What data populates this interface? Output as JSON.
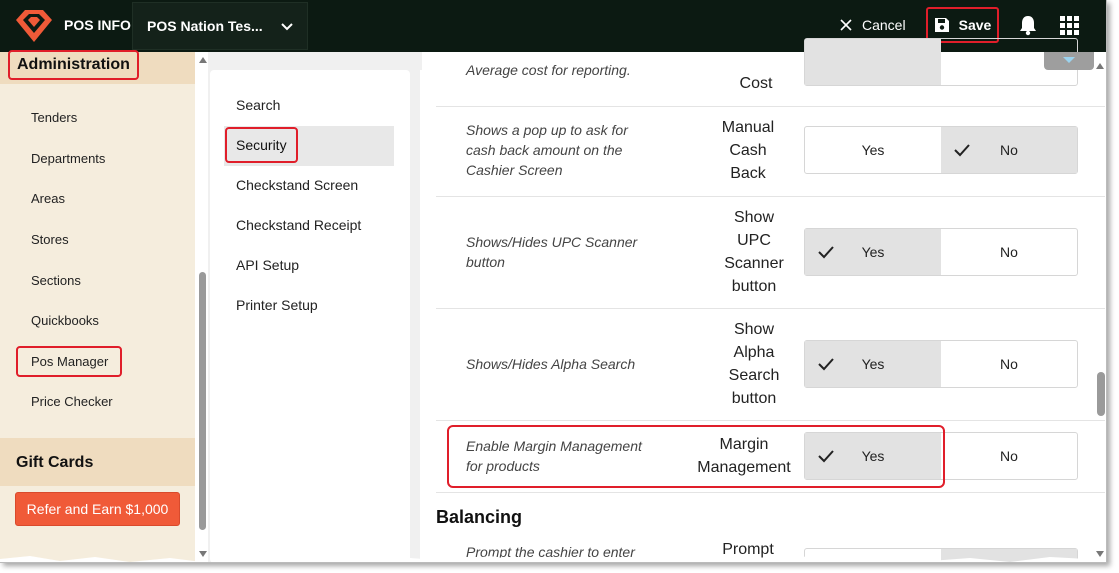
{
  "header": {
    "app_name": "POS INFO",
    "store_name": "POS Nation Tes...",
    "cancel_label": "Cancel",
    "save_label": "Save",
    "colors": {
      "topbar": "#0c1a12",
      "logo": "#f05a38",
      "highlight": "#e01e2a"
    }
  },
  "sidebar": {
    "section_title": "Administration",
    "items": [
      {
        "label": "Tenders"
      },
      {
        "label": "Departments"
      },
      {
        "label": "Areas"
      },
      {
        "label": "Stores"
      },
      {
        "label": "Sections"
      },
      {
        "label": "Quickbooks"
      },
      {
        "label": "Pos Manager",
        "active": true
      },
      {
        "label": "Price Checker"
      }
    ],
    "gift_title": "Gift Cards",
    "refer_label": "Refer and Earn $1,000"
  },
  "subnav": {
    "items": [
      {
        "label": "Search"
      },
      {
        "label": "Security",
        "active": true
      },
      {
        "label": "Checkstand Screen"
      },
      {
        "label": "Checkstand Receipt"
      },
      {
        "label": "API Setup"
      },
      {
        "label": "Printer Setup"
      }
    ]
  },
  "settings": {
    "rows": [
      {
        "description": "Average cost for reporting.",
        "name": "Cost",
        "selected": "No"
      },
      {
        "description": "Shows a pop up to ask for cash back amount on the Cashier Screen",
        "name": "Manual Cash Back",
        "name_lines": [
          "Manual",
          "Cash",
          "Back"
        ],
        "selected": "No"
      },
      {
        "description": "Shows/Hides UPC Scanner button",
        "name": "Show UPC Scanner button",
        "name_lines": [
          "Show",
          "UPC",
          "Scanner",
          "button"
        ],
        "selected": "Yes"
      },
      {
        "description": "Shows/Hides Alpha Search",
        "name": "Show Alpha Search button",
        "name_lines": [
          "Show",
          "Alpha",
          "Search",
          "button"
        ],
        "selected": "Yes"
      },
      {
        "description": "Enable Margin Management for products",
        "name": "Margin Management",
        "name_lines": [
          "Margin",
          "Management"
        ],
        "selected": "Yes"
      }
    ],
    "yes_label": "Yes",
    "no_label": "No",
    "section_balancing": "Balancing",
    "balancing_first": {
      "description": "Prompt the cashier to enter",
      "name": "Prompt"
    }
  }
}
